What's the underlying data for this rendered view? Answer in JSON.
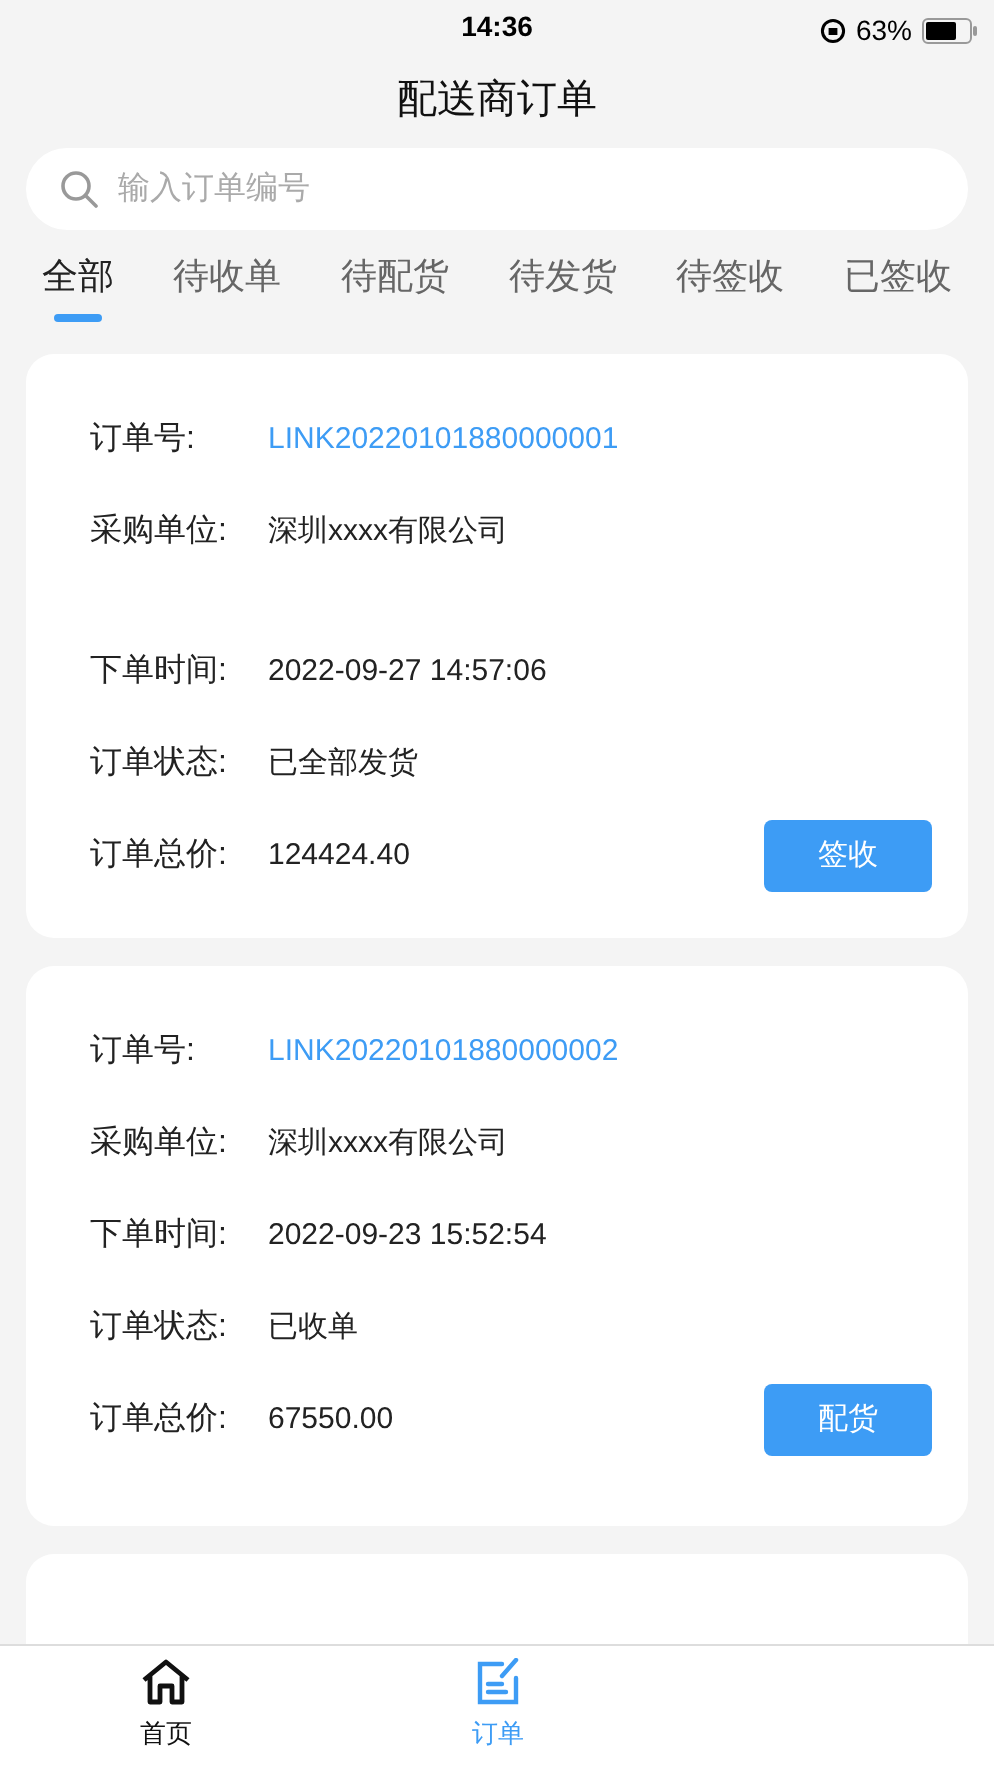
{
  "status_bar": {
    "time": "14:36",
    "battery_text": "63%"
  },
  "title": "配送商订单",
  "search": {
    "placeholder": "输入订单编号"
  },
  "tabs": [
    {
      "label": "全部",
      "selected": true
    },
    {
      "label": "待收单",
      "selected": false
    },
    {
      "label": "待配货",
      "selected": false
    },
    {
      "label": "待发货",
      "selected": false
    },
    {
      "label": "待签收",
      "selected": false
    },
    {
      "label": "已签收",
      "selected": false
    }
  ],
  "orders": [
    {
      "fields": [
        {
          "label": "订单号:",
          "value": "LINK20220101880000001",
          "kind": "link"
        },
        {
          "label": "采购单位:",
          "value": "深圳xxxx有限公司",
          "kind": "text"
        },
        {
          "label": "下单时间:",
          "value": "2022-09-27 14:57:06",
          "kind": "text"
        },
        {
          "label": "订单状态:",
          "value": "已全部发货",
          "kind": "text"
        },
        {
          "label": "订单总价:",
          "value": "124424.40",
          "kind": "text"
        }
      ],
      "action": "签收"
    },
    {
      "fields": [
        {
          "label": "订单号:",
          "value": "LINK20220101880000002",
          "kind": "link"
        },
        {
          "label": "采购单位:",
          "value": "深圳xxxx有限公司",
          "kind": "text"
        },
        {
          "label": "下单时间:",
          "value": "2022-09-23 15:52:54",
          "kind": "text"
        },
        {
          "label": "订单状态:",
          "value": "已收单",
          "kind": "text"
        },
        {
          "label": "订单总价:",
          "value": "67550.00",
          "kind": "text"
        }
      ],
      "action": "配货"
    },
    {
      "kind": "cut_off"
    }
  ],
  "nav": [
    {
      "label": "首页",
      "kind": "home",
      "selected": false
    },
    {
      "label": "订单",
      "kind": "orders",
      "selected": true
    }
  ]
}
